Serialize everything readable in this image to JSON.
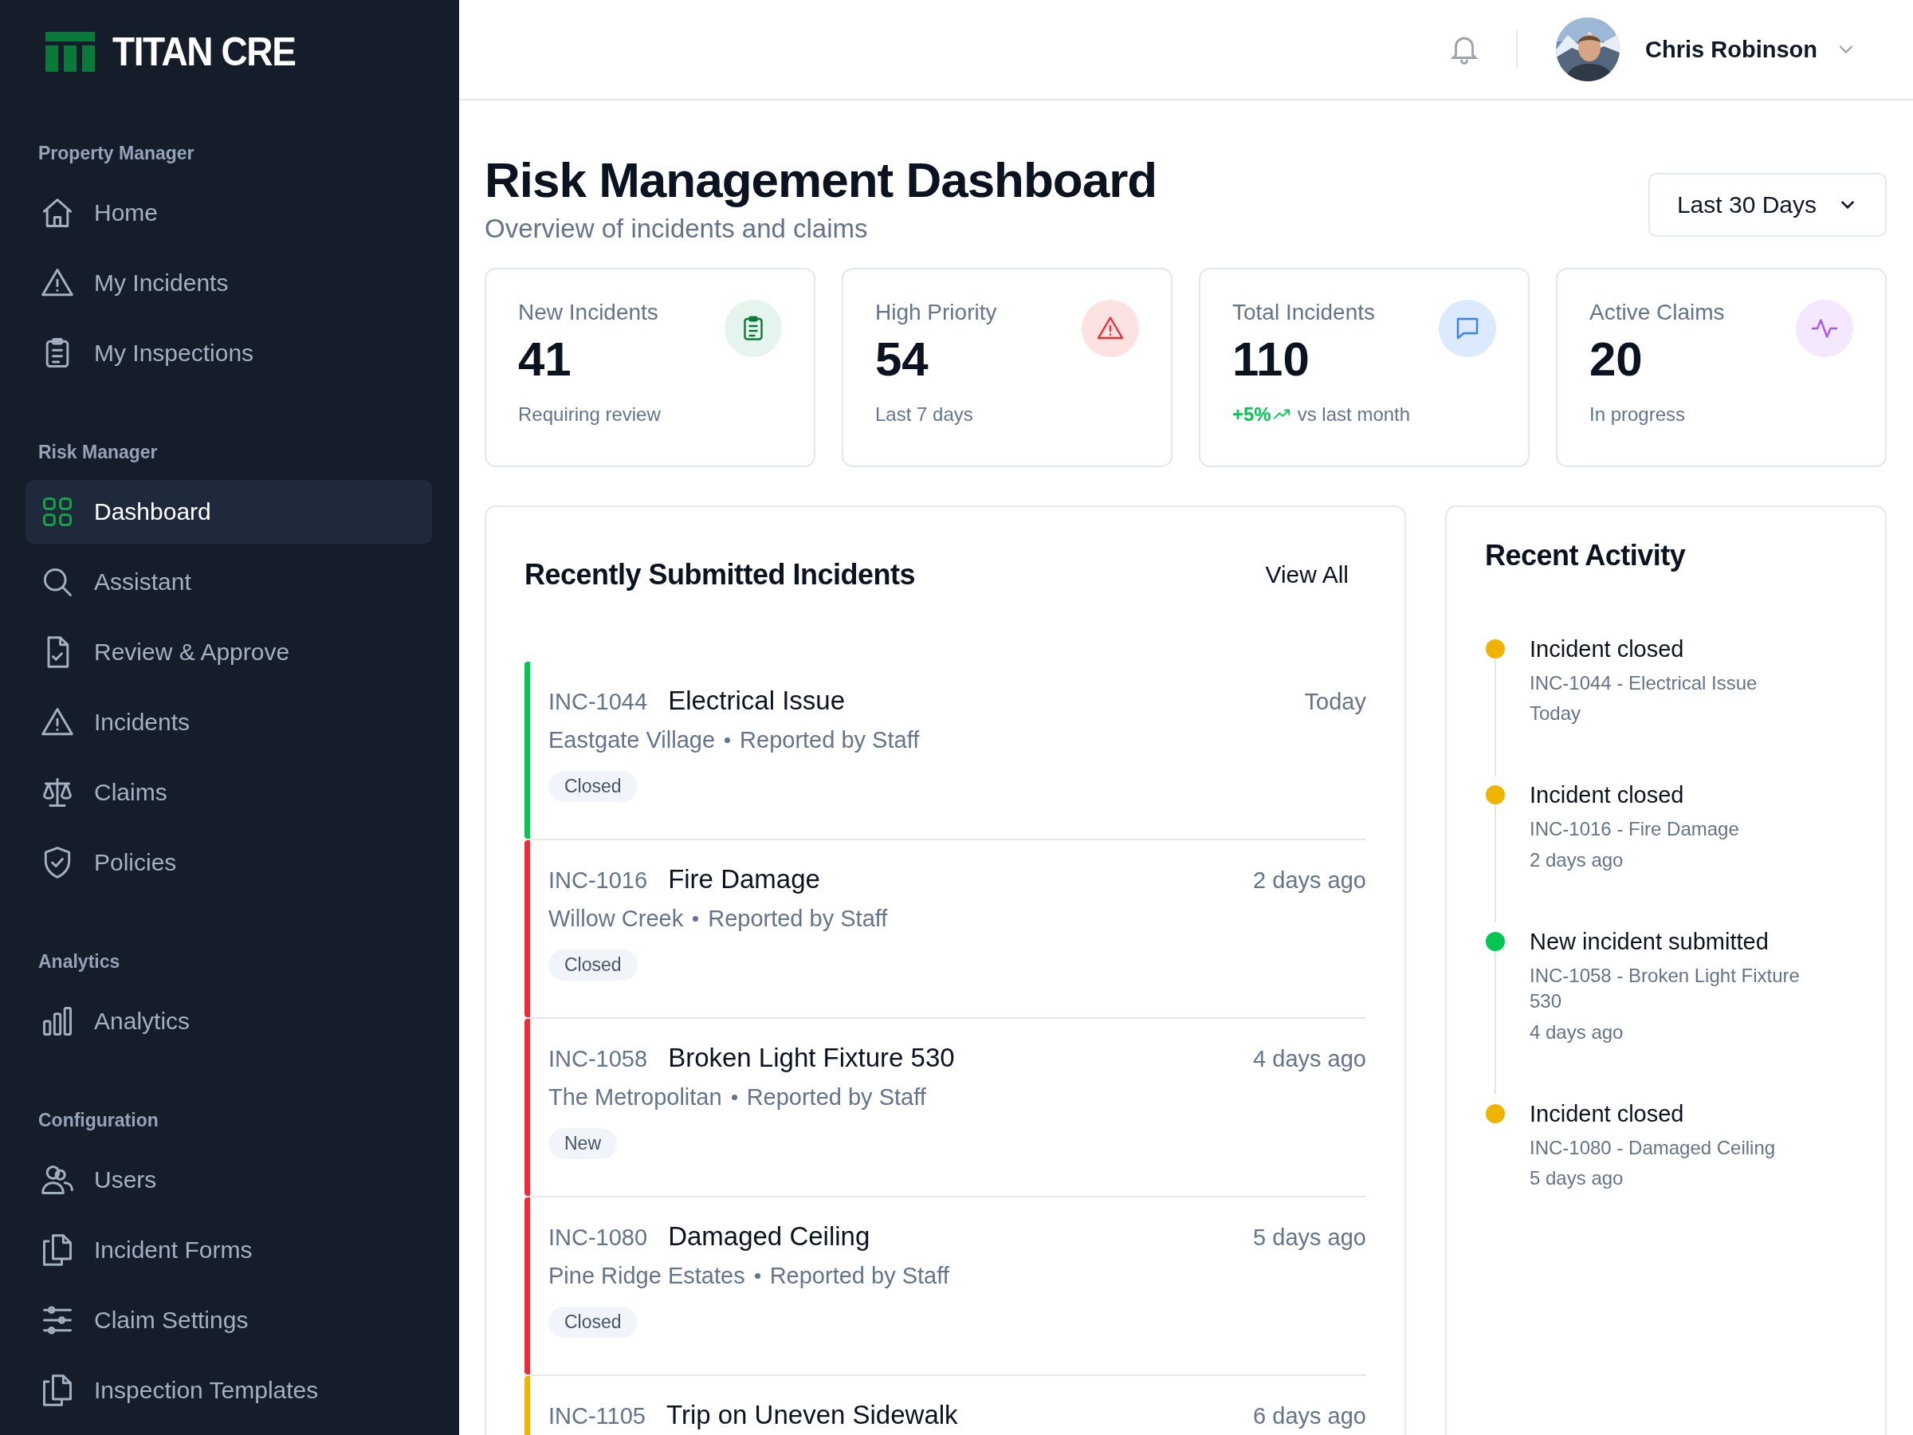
{
  "brand": {
    "name": "TITAN CRE"
  },
  "sidebar": {
    "sections": [
      {
        "label": "Property Manager",
        "items": [
          {
            "label": "Home",
            "selected": false
          },
          {
            "label": "My Incidents",
            "selected": false
          },
          {
            "label": "My Inspections",
            "selected": false
          }
        ]
      },
      {
        "label": "Risk Manager",
        "items": [
          {
            "label": "Dashboard",
            "selected": true
          },
          {
            "label": "Assistant",
            "selected": false
          },
          {
            "label": "Review & Approve",
            "selected": false
          },
          {
            "label": "Incidents",
            "selected": false
          },
          {
            "label": "Claims",
            "selected": false
          },
          {
            "label": "Policies",
            "selected": false
          }
        ]
      },
      {
        "label": "Analytics",
        "items": [
          {
            "label": "Analytics",
            "selected": false
          }
        ]
      },
      {
        "label": "Configuration",
        "items": [
          {
            "label": "Users",
            "selected": false
          },
          {
            "label": "Incident Forms",
            "selected": false
          },
          {
            "label": "Claim Settings",
            "selected": false
          },
          {
            "label": "Inspection Templates",
            "selected": false
          }
        ]
      }
    ]
  },
  "header": {
    "user_name": "Chris Robinson"
  },
  "page": {
    "title": "Risk Management Dashboard",
    "subtitle": "Overview of incidents and claims",
    "period": "Last 30 Days"
  },
  "stats": [
    {
      "label": "New Incidents",
      "value": "41",
      "note": "Requiring review"
    },
    {
      "label": "High Priority",
      "value": "54",
      "note": "Last 7 days"
    },
    {
      "label": "Total Incidents",
      "value": "110",
      "trend": "+5%",
      "note": "vs last month"
    },
    {
      "label": "Active Claims",
      "value": "20",
      "note": "In progress"
    }
  ],
  "incidents": {
    "title": "Recently Submitted Incidents",
    "view_all": "View All",
    "rows": [
      {
        "id": "INC-1044",
        "title": "Electrical Issue",
        "property": "Eastgate Village",
        "reporter": "Reported by Staff",
        "status": "Closed",
        "time": "Today",
        "color": "#00c853"
      },
      {
        "id": "INC-1016",
        "title": "Fire Damage",
        "property": "Willow Creek",
        "reporter": "Reported by Staff",
        "status": "Closed",
        "time": "2 days ago",
        "color": "#ef2b36"
      },
      {
        "id": "INC-1058",
        "title": "Broken Light Fixture 530",
        "property": "The Metropolitan",
        "reporter": "Reported by Staff",
        "status": "New",
        "time": "4 days ago",
        "color": "#ef2b36"
      },
      {
        "id": "INC-1080",
        "title": "Damaged Ceiling",
        "property": "Pine Ridge Estates",
        "reporter": "Reported by Staff",
        "status": "Closed",
        "time": "5 days ago",
        "color": "#ef2b36"
      },
      {
        "id": "INC-1105",
        "title": "Trip on Uneven Sidewalk",
        "time": "6 days ago",
        "color": "#f0b400"
      }
    ]
  },
  "activity": {
    "title": "Recent Activity",
    "items": [
      {
        "title": "Incident closed",
        "detail": "INC-1044 - Electrical Issue",
        "time": "Today",
        "color": "#f0b400"
      },
      {
        "title": "Incident closed",
        "detail": "INC-1016 - Fire Damage",
        "time": "2 days ago",
        "color": "#f0b400"
      },
      {
        "title": "New incident submitted",
        "detail": "INC-1058 - Broken Light Fixture 530",
        "time": "4 days ago",
        "color": "#00c853"
      },
      {
        "title": "Incident closed",
        "detail": "INC-1080 - Damaged Ceiling",
        "time": "5 days ago",
        "color": "#f0b400"
      }
    ]
  }
}
